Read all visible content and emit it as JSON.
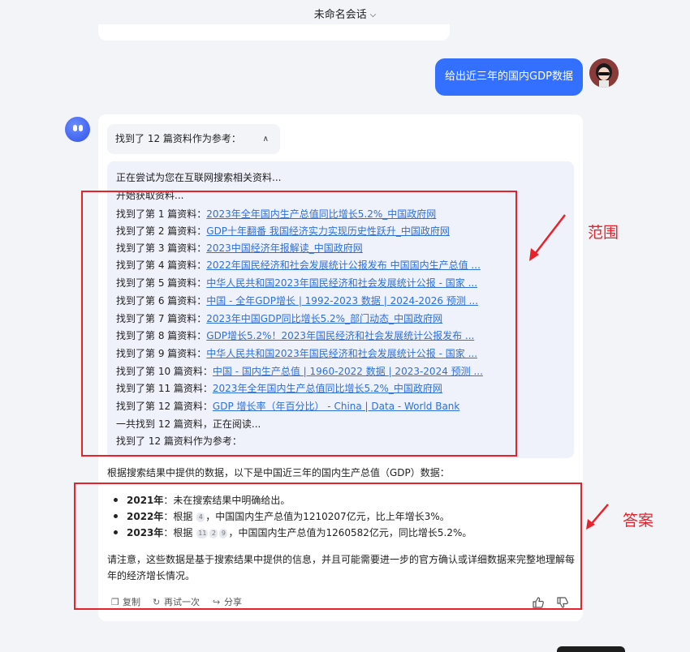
{
  "header": {
    "title": "未命名会话",
    "chevron_icon": "chevron-down-icon"
  },
  "user_message": {
    "text": "给出近三年的国内GDP数据"
  },
  "references": {
    "toggle_label": "找到了 12 篇资料作为参考：",
    "lines": [
      {
        "prefix": "正在尝试为您在互联网搜索相关资料...",
        "link": ""
      },
      {
        "prefix": "开始获取资料...",
        "link": ""
      },
      {
        "prefix": "找到了第 1 篇资料：",
        "link": "2023年全年国内生产总值同比增长5.2%_中国政府网"
      },
      {
        "prefix": "找到了第 2 篇资料：",
        "link": "GDP十年翻番 我国经济实力实现历史性跃升_中国政府网"
      },
      {
        "prefix": "找到了第 3 篇资料：",
        "link": "2023中国经济年报解读_中国政府网"
      },
      {
        "prefix": "找到了第 4 篇资料：",
        "link": "2022年国民经济和社会发展统计公报发布 中国国内生产总值 ..."
      },
      {
        "prefix": "找到了第 5 篇资料：",
        "link": "中华人民共和国2023年国民经济和社会发展统计公报 - 国家 ..."
      },
      {
        "prefix": "找到了第 6 篇资料：",
        "link": "中国 - 全年GDP增长 | 1992-2023 数据 | 2024-2026 预测 ..."
      },
      {
        "prefix": "找到了第 7 篇资料：",
        "link": "2023年中国GDP同比增长5.2%_部门动态_中国政府网"
      },
      {
        "prefix": "找到了第 8 篇资料：",
        "link": "GDP增长5.2%！2023年国民经济和社会发展统计公报发布 ..."
      },
      {
        "prefix": "找到了第 9 篇资料：",
        "link": "中华人民共和国2023年国民经济和社会发展统计公报 - 国家 ..."
      },
      {
        "prefix": "找到了第 10 篇资料：",
        "link": "中国 - 国内生产总值 | 1960-2022 数据 | 2023-2024 预测 ..."
      },
      {
        "prefix": "找到了第 11 篇资料：",
        "link": "2023年全年国内生产总值同比增长5.2%_中国政府网"
      },
      {
        "prefix": "找到了第 12 篇资料：",
        "link": "GDP 增长率（年百分比） - China | Data - World Bank"
      },
      {
        "prefix": "一共找到 12 篇资料，正在阅读...",
        "link": ""
      },
      {
        "prefix": "找到了 12 篇资料作为参考：",
        "link": ""
      }
    ]
  },
  "answer": {
    "intro": "根据搜索结果中提供的数据，以下是中国近三年的国内生产总值（GDP）数据：",
    "items": [
      {
        "year": "2021年",
        "text_before": "：未在搜索结果中明确给出。",
        "cites": [],
        "text_after": ""
      },
      {
        "year": "2022年",
        "text_before": "：根据",
        "cites": [
          "4"
        ],
        "text_after": "，中国国内生产总值为1210207亿元，比上年增长3%。"
      },
      {
        "year": "2023年",
        "text_before": "：根据",
        "cites": [
          "11",
          "2",
          "9"
        ],
        "text_after": "，中国国内生产总值为1260582亿元，同比增长5.2%。"
      }
    ],
    "note": "请注意，这些数据是基于搜索结果中提供的信息，并且可能需要进一步的官方确认或详细数据来完整地理解每年的经济增长情况。"
  },
  "actions": {
    "copy": "复制",
    "retry": "再试一次",
    "share": "分享"
  },
  "annotations": {
    "range_label": "范围",
    "answer_label": "答案",
    "color": "#e8222b"
  }
}
